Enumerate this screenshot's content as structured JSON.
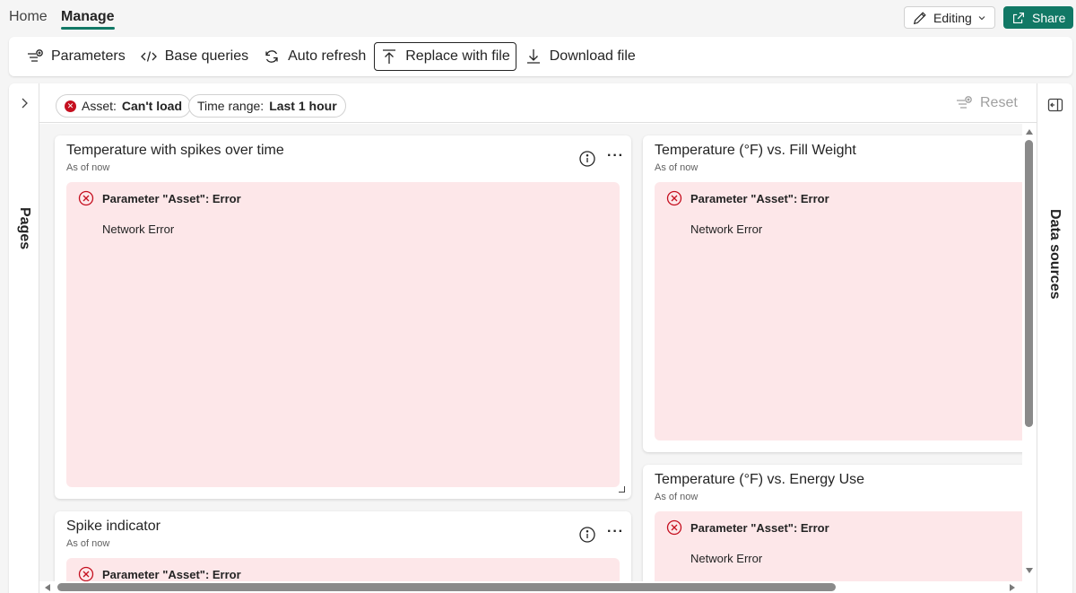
{
  "tabs": {
    "home": "Home",
    "manage": "Manage"
  },
  "header": {
    "editing_label": "Editing",
    "share_label": "Share"
  },
  "toolbar": {
    "parameters": "Parameters",
    "base_queries": "Base queries",
    "auto_refresh": "Auto refresh",
    "replace_with_file": "Replace with file",
    "download_file": "Download file"
  },
  "rails": {
    "pages": "Pages",
    "data_sources": "Data sources"
  },
  "filters": {
    "asset_label": "Asset:",
    "asset_value": "Can't load",
    "time_label": "Time range:",
    "time_value": "Last 1 hour",
    "reset": "Reset"
  },
  "tiles": [
    {
      "title": "Temperature with spikes over time",
      "subtitle": "As of now",
      "error_title": "Parameter \"Asset\": Error",
      "error_message": "Network Error"
    },
    {
      "title": "Temperature (°F) vs. Fill Weight",
      "subtitle": "As of now",
      "error_title": "Parameter \"Asset\": Error",
      "error_message": "Network Error"
    },
    {
      "title": "Temperature (°F) vs. Energy Use",
      "subtitle": "As of now",
      "error_title": "Parameter \"Asset\": Error",
      "error_message": "Network Error"
    },
    {
      "title": "Spike indicator",
      "subtitle": "As of now",
      "error_title": "Parameter \"Asset\": Error",
      "error_message": ""
    }
  ],
  "colors": {
    "accent": "#117865",
    "error": "#c50f1f",
    "error_bg": "#fde7e9"
  }
}
